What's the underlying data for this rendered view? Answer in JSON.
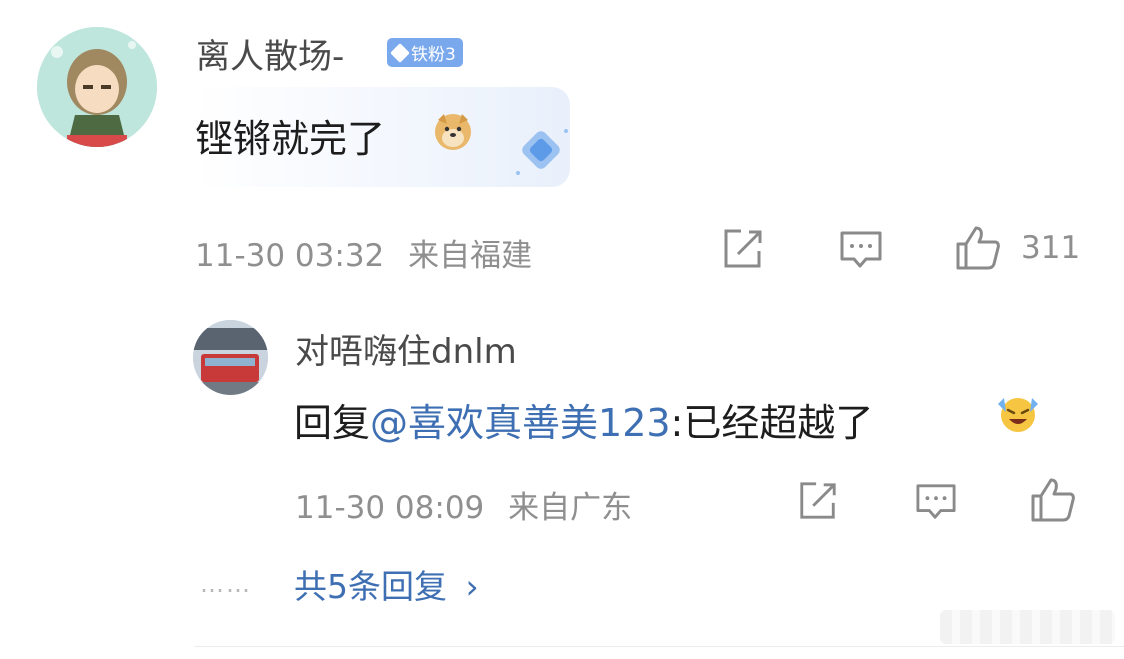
{
  "comment": {
    "username": "离人散场-",
    "badge_label": "铁粉3",
    "text": "铿锵就完了",
    "emoji": "doge",
    "time": "11-30 03:32",
    "location": "来自福建",
    "like_count": "311"
  },
  "reply": {
    "username": "对唔嗨住dnlm",
    "prefix": "回复",
    "mention": "@喜欢真善美123",
    "text": ":已经超越了",
    "emoji": "laugh-cry",
    "time": "11-30 08:09",
    "location": "来自广东"
  },
  "more": {
    "dots": "……",
    "label": "共5条回复",
    "chevron": "›"
  },
  "icons": {
    "share": "share-icon",
    "comment": "comment-icon",
    "like": "thumbs-up-icon"
  },
  "colors": {
    "mention": "#3f6fb3",
    "badge": "#7aa8ec",
    "meta": "#8f8f8f"
  }
}
